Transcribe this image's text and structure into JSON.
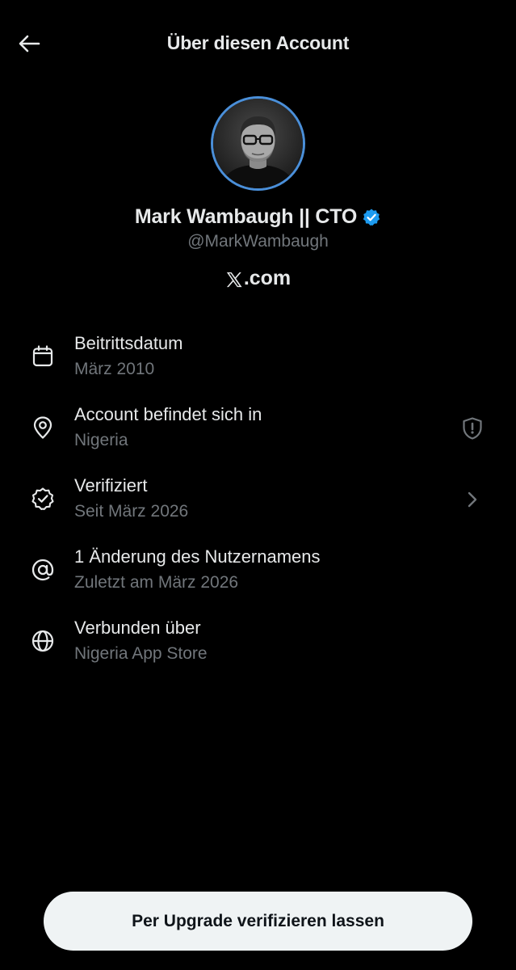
{
  "header": {
    "title": "Über diesen Account",
    "back_icon": "arrow-left-icon"
  },
  "profile": {
    "name": "Mark Wambaugh || CTO",
    "handle": "@MarkWambaugh",
    "site_suffix": ".com",
    "verified": true,
    "badge_color": "#1d9bf0",
    "avatar_ring_color": "#4a8fd9"
  },
  "info": [
    {
      "icon": "calendar-icon",
      "label": "Beitrittsdatum",
      "value": "März 2010"
    },
    {
      "icon": "location-pin-icon",
      "label": "Account befindet sich in",
      "value": "Nigeria",
      "trail_icon": "shield-exclamation-icon"
    },
    {
      "icon": "verified-check-icon",
      "label": "Verifiziert",
      "value": "Seit März 2026",
      "trail_icon": "chevron-right-icon"
    },
    {
      "icon": "at-sign-icon",
      "label": "1 Änderung des Nutzernamens",
      "value": "Zuletzt am März 2026"
    },
    {
      "icon": "globe-icon",
      "label": "Verbunden über",
      "value": "Nigeria App Store"
    }
  ],
  "footer": {
    "upgrade_label": "Per Upgrade verifizieren lassen"
  },
  "colors": {
    "background": "#000000",
    "text_primary": "#e7e9ea",
    "text_secondary": "#71767b",
    "button_bg": "#eff3f4"
  }
}
